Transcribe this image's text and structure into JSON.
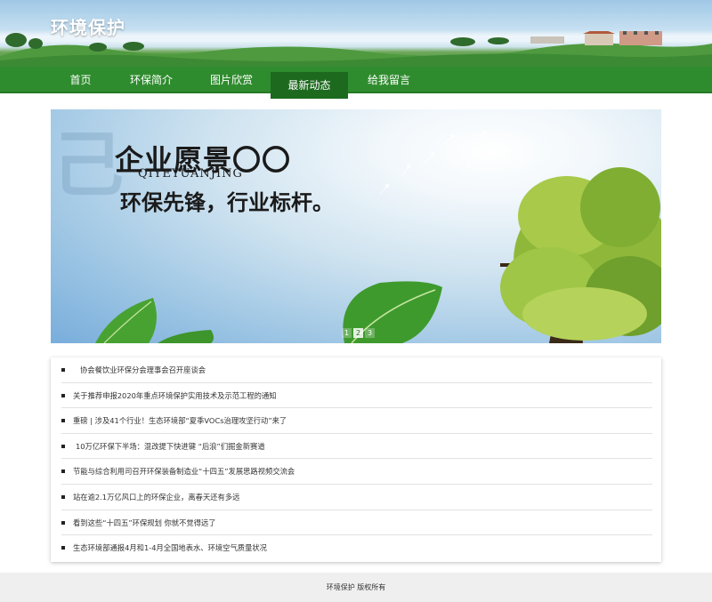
{
  "header": {
    "site_title": "环境保护"
  },
  "nav": {
    "items": [
      {
        "label": "首页"
      },
      {
        "label": "环保简介"
      },
      {
        "label": "图片欣赏"
      },
      {
        "label": "最新动态"
      },
      {
        "label": "给我留言"
      }
    ],
    "active_index": 3
  },
  "banner": {
    "title": "企业愿景〇〇",
    "pinyin": "QIYEYUANJING",
    "slogan": "环保先锋，行业标杆。",
    "pagination": [
      "1",
      "2",
      "3"
    ],
    "active_page": 2
  },
  "news": {
    "items": [
      "协会餐饮业环保分会理事会召开座谈会",
      "关于推荐申报2020年重点环境保护实用技术及示范工程的通知",
      "重磅 | 涉及41个行业！生态环境部“夏季VOCs治理攻坚行动”来了",
      "10万亿环保下半场：混改提下快进键 “后浪”们掘金新赛道",
      "节能与综合利用司召开环保装备制造业“十四五”发展思路视频交流会",
      "站在逾2.1万亿风口上的环保企业，离春天还有多远",
      "看到这些“十四五”环保规划 你就不觉得远了",
      "生态环境部通报4月和1-4月全国地表水、环境空气质量状况"
    ]
  },
  "footer": {
    "copyright": "环境保护 版权所有"
  },
  "colors": {
    "nav_green": "#2f8c2e",
    "nav_active": "#1d6a1f",
    "footer_bg": "#efefef"
  }
}
